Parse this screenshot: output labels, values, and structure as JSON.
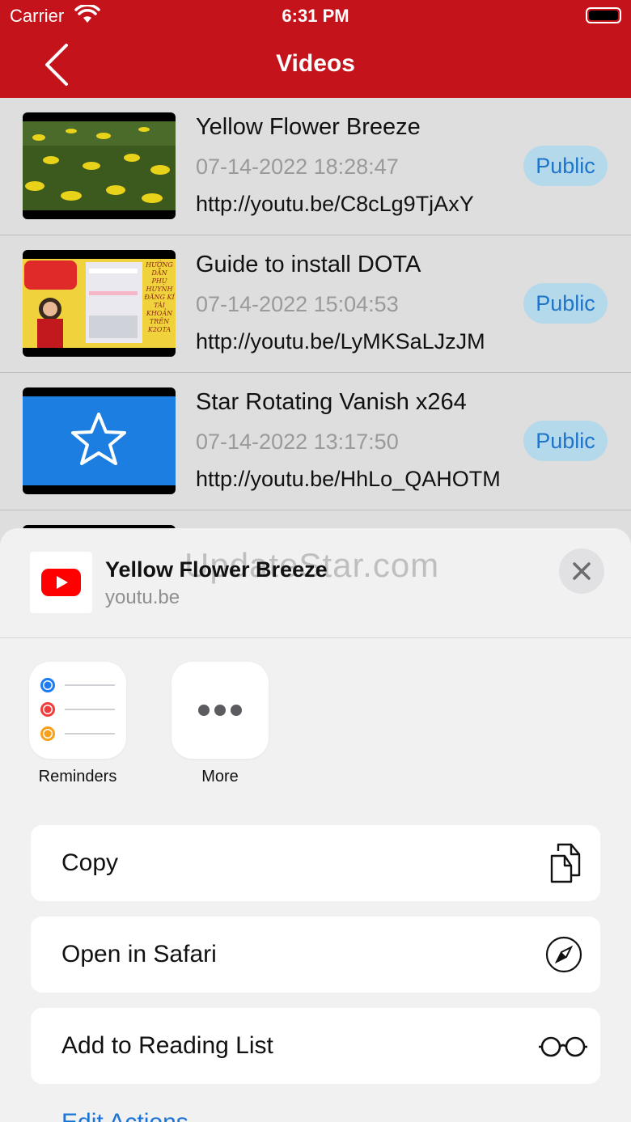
{
  "status": {
    "carrier": "Carrier",
    "time": "6:31 PM"
  },
  "nav": {
    "title": "Videos"
  },
  "videos": [
    {
      "title": "Yellow Flower Breeze",
      "date": "07-14-2022 18:28:47",
      "url": "http://youtu.be/C8cLg9TjAxY",
      "visibility": "Public"
    },
    {
      "title": "Guide to install DOTA",
      "date": "07-14-2022 15:04:53",
      "url": "http://youtu.be/LyMKSaLJzJM",
      "visibility": "Public"
    },
    {
      "title": "Star Rotating Vanish x264",
      "date": "07-14-2022 13:17:50",
      "url": "http://youtu.be/HhLo_QAHOTM",
      "visibility": "Public"
    }
  ],
  "thumb2_text": [
    "HƯỚNG",
    "DẪN PHỤ",
    "HUYNH",
    "ĐĂNG KÍ",
    "TÀI",
    "KHOẢN",
    "TRÊN",
    "K2OTA"
  ],
  "share": {
    "title": "Yellow Flower Breeze",
    "subtitle": "youtu.be",
    "watermark": "UpdateStar.com",
    "apps": [
      {
        "label": "Reminders"
      },
      {
        "label": "More"
      }
    ],
    "actions": [
      {
        "label": "Copy"
      },
      {
        "label": "Open in Safari"
      },
      {
        "label": "Add to Reading List"
      }
    ],
    "edit_actions": "Edit Actions..."
  },
  "colors": {
    "brand": "#c4131b",
    "badge_bg": "#b3d9eb",
    "badge_text": "#1f74c9",
    "link": "#1a74d6"
  }
}
